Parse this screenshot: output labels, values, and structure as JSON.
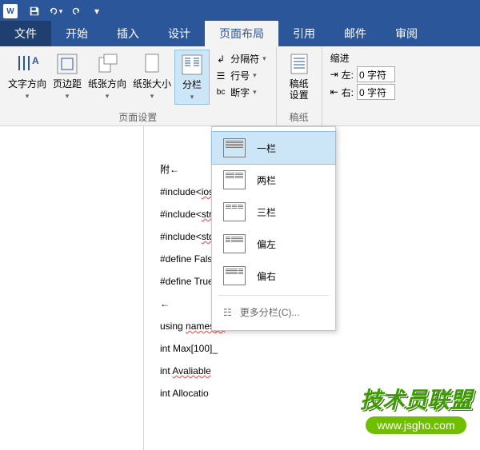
{
  "qat": {
    "app": "W"
  },
  "tabs": {
    "file": "文件",
    "home": "开始",
    "insert": "插入",
    "design": "设计",
    "layout": "页面布局",
    "ref": "引用",
    "mail": "邮件",
    "review": "审阅"
  },
  "ribbon": {
    "textdir": "文字方向",
    "margins": "页边距",
    "orient": "纸张方向",
    "size": "纸张大小",
    "columns": "分栏",
    "breaks": "分隔符",
    "linenum": "行号",
    "hyphen": "断字",
    "manuscript": "稿纸\n设置",
    "indent": "缩进",
    "left": "左:",
    "right": "右:",
    "leftval": "0 字符",
    "rightval": "0 字符",
    "grp_page": "页面设置",
    "grp_manuscript": "稿纸"
  },
  "dropdown": {
    "one": "一栏",
    "two": "两栏",
    "three": "三栏",
    "left": "偏左",
    "right": "偏右",
    "more": "更多分栏(C)..."
  },
  "doc": {
    "l0": "附←",
    "l1": "#include<iost",
    "u1": "iost",
    "l2": "#include<stri",
    "u2": "stri",
    "l3": "#include<stdi",
    "u3": "stdi",
    "l4": "#define False",
    "l5": "#define True ",
    "l6": "←",
    "l7": "using namespa",
    "u7": "namespa",
    "l8": "int Max[100]_",
    "l9": "int Avaliable",
    "u9": "Avaliable",
    "l10": "int Allocatio"
  },
  "watermark": {
    "text": "技术员联盟",
    "url": "www.jsgho.com"
  }
}
